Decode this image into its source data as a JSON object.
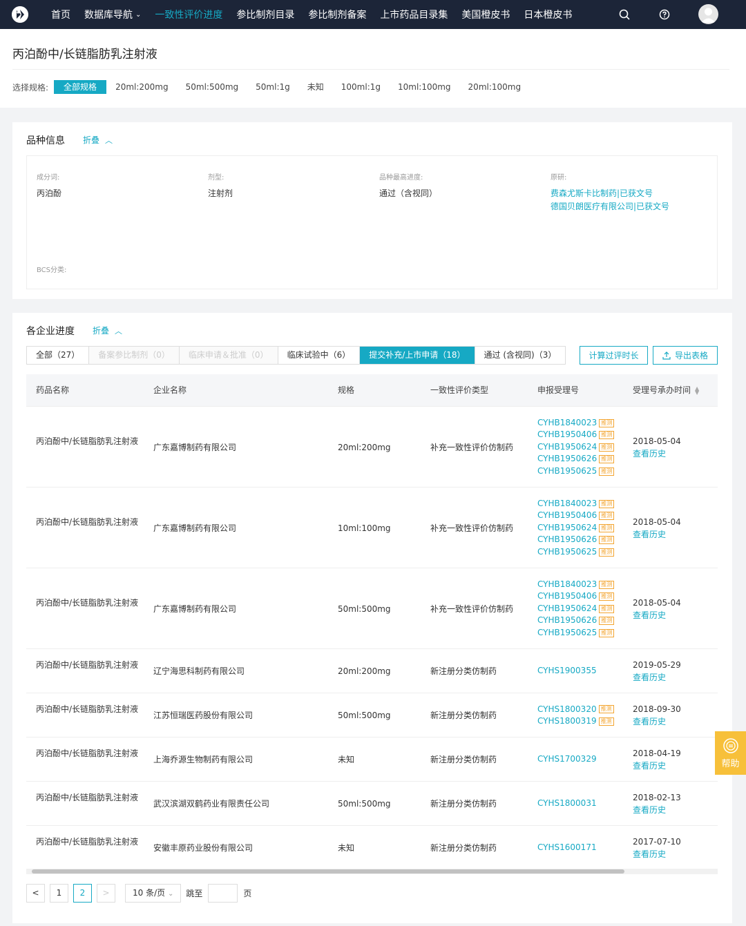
{
  "nav": {
    "items": [
      {
        "label": "首页",
        "active": false,
        "caret": ""
      },
      {
        "label": "数据库导航",
        "active": false,
        "caret": "⌄"
      },
      {
        "label": "一致性评价进度",
        "active": true,
        "caret": ""
      },
      {
        "label": "参比制剂目录",
        "active": false,
        "caret": ""
      },
      {
        "label": "参比制剂备案",
        "active": false,
        "caret": ""
      },
      {
        "label": "上市药品目录集",
        "active": false,
        "caret": ""
      },
      {
        "label": "美国橙皮书",
        "active": false,
        "caret": ""
      },
      {
        "label": "日本橙皮书",
        "active": false,
        "caret": ""
      }
    ]
  },
  "page": {
    "title": "丙泊酚中/长链脂肪乳注射液",
    "spec_label": "选择规格:",
    "specs": [
      "全部规格",
      "20ml:200mg",
      "50ml:500mg",
      "50ml:1g",
      "未知",
      "100ml:1g",
      "10ml:100mg",
      "20ml:100mg"
    ]
  },
  "variety": {
    "title": "品种信息",
    "fold": "折叠",
    "ingredient_key": "成分词:",
    "ingredient_val": "丙泊酚",
    "form_key": "剂型:",
    "form_val": "注射剂",
    "progress_key": "品种最高进度:",
    "progress_val": "通过（含视同）",
    "origin_key": "原研:",
    "origin_links": [
      "费森尤斯卡比制药|已获文号",
      "德国贝朗医疗有限公司|已获文号"
    ],
    "bcs_key": "BCS分类:"
  },
  "progress": {
    "title": "各企业进度",
    "fold": "折叠",
    "tabs": [
      {
        "label": "全部（27）",
        "state": "normal"
      },
      {
        "label": "备案参比制剂（0）",
        "state": "disabled"
      },
      {
        "label": "临床申请＆批准（0）",
        "state": "disabled"
      },
      {
        "label": "临床试验中（6）",
        "state": "normal"
      },
      {
        "label": "提交补充/上市申请（18）",
        "state": "active"
      },
      {
        "label": "通过 (含视同)（3）",
        "state": "normal"
      }
    ],
    "calc_button": "计算过评时长",
    "export_button": "导出表格",
    "columns": [
      "药品名称",
      "企业名称",
      "规格",
      "一致性评价类型",
      "申报受理号",
      "受理号承办时间"
    ],
    "tag_label": "推测",
    "history_label": "查看历史",
    "rows": [
      {
        "drug": "丙泊酚中/长链脂肪乳注射液",
        "company": "广东嘉博制药有限公司",
        "spec": "20ml:200mg",
        "type": "补充一致性评价仿制药",
        "accepts": [
          {
            "no": "CYHB1840023",
            "tag": true
          },
          {
            "no": "CYHB1950406",
            "tag": true
          },
          {
            "no": "CYHB1950624",
            "tag": true
          },
          {
            "no": "CYHB1950626",
            "tag": true
          },
          {
            "no": "CYHB1950625",
            "tag": true
          }
        ],
        "date": "2018-05-04"
      },
      {
        "drug": "丙泊酚中/长链脂肪乳注射液",
        "company": "广东嘉博制药有限公司",
        "spec": "10ml:100mg",
        "type": "补充一致性评价仿制药",
        "accepts": [
          {
            "no": "CYHB1840023",
            "tag": true
          },
          {
            "no": "CYHB1950406",
            "tag": true
          },
          {
            "no": "CYHB1950624",
            "tag": true
          },
          {
            "no": "CYHB1950626",
            "tag": true
          },
          {
            "no": "CYHB1950625",
            "tag": true
          }
        ],
        "date": "2018-05-04"
      },
      {
        "drug": "丙泊酚中/长链脂肪乳注射液",
        "company": "广东嘉博制药有限公司",
        "spec": "50ml:500mg",
        "type": "补充一致性评价仿制药",
        "accepts": [
          {
            "no": "CYHB1840023",
            "tag": true
          },
          {
            "no": "CYHB1950406",
            "tag": true
          },
          {
            "no": "CYHB1950624",
            "tag": true
          },
          {
            "no": "CYHB1950626",
            "tag": true
          },
          {
            "no": "CYHB1950625",
            "tag": true
          }
        ],
        "date": "2018-05-04"
      },
      {
        "drug": "丙泊酚中/长链脂肪乳注射液",
        "company": "辽宁海思科制药有限公司",
        "spec": "20ml:200mg",
        "type": "新注册分类仿制药",
        "accepts": [
          {
            "no": "CYHS1900355",
            "tag": false
          }
        ],
        "date": "2019-05-29"
      },
      {
        "drug": "丙泊酚中/长链脂肪乳注射液",
        "company": "江苏恒瑞医药股份有限公司",
        "spec": "50ml:500mg",
        "type": "新注册分类仿制药",
        "accepts": [
          {
            "no": "CYHS1800320",
            "tag": true
          },
          {
            "no": "CYHS1800319",
            "tag": true
          }
        ],
        "date": "2018-09-30"
      },
      {
        "drug": "丙泊酚中/长链脂肪乳注射液",
        "company": "上海乔源生物制药有限公司",
        "spec": "未知",
        "type": "新注册分类仿制药",
        "accepts": [
          {
            "no": "CYHS1700329",
            "tag": false
          }
        ],
        "date": "2018-04-19"
      },
      {
        "drug": "丙泊酚中/长链脂肪乳注射液",
        "company": "武汉滨湖双鹤药业有限责任公司",
        "spec": "50ml:500mg",
        "type": "新注册分类仿制药",
        "accepts": [
          {
            "no": "CYHS1800031",
            "tag": false
          }
        ],
        "date": "2018-02-13"
      },
      {
        "drug": "丙泊酚中/长链脂肪乳注射液",
        "company": "安徽丰原药业股份有限公司",
        "spec": "未知",
        "type": "新注册分类仿制药",
        "accepts": [
          {
            "no": "CYHS1600171",
            "tag": false
          }
        ],
        "date": "2017-07-10"
      }
    ]
  },
  "pagination": {
    "prev": "<",
    "pages": [
      "1",
      "2"
    ],
    "current": "2",
    "next": ">",
    "page_size": "10 条/页",
    "jump_label": "跳至",
    "page_suffix": "页"
  },
  "help": {
    "label": "帮助"
  },
  "colors": {
    "nav_bg": "#1c2538",
    "accent": "#16a9c4",
    "tag": "#f3a42f",
    "help": "#f7c03a"
  }
}
